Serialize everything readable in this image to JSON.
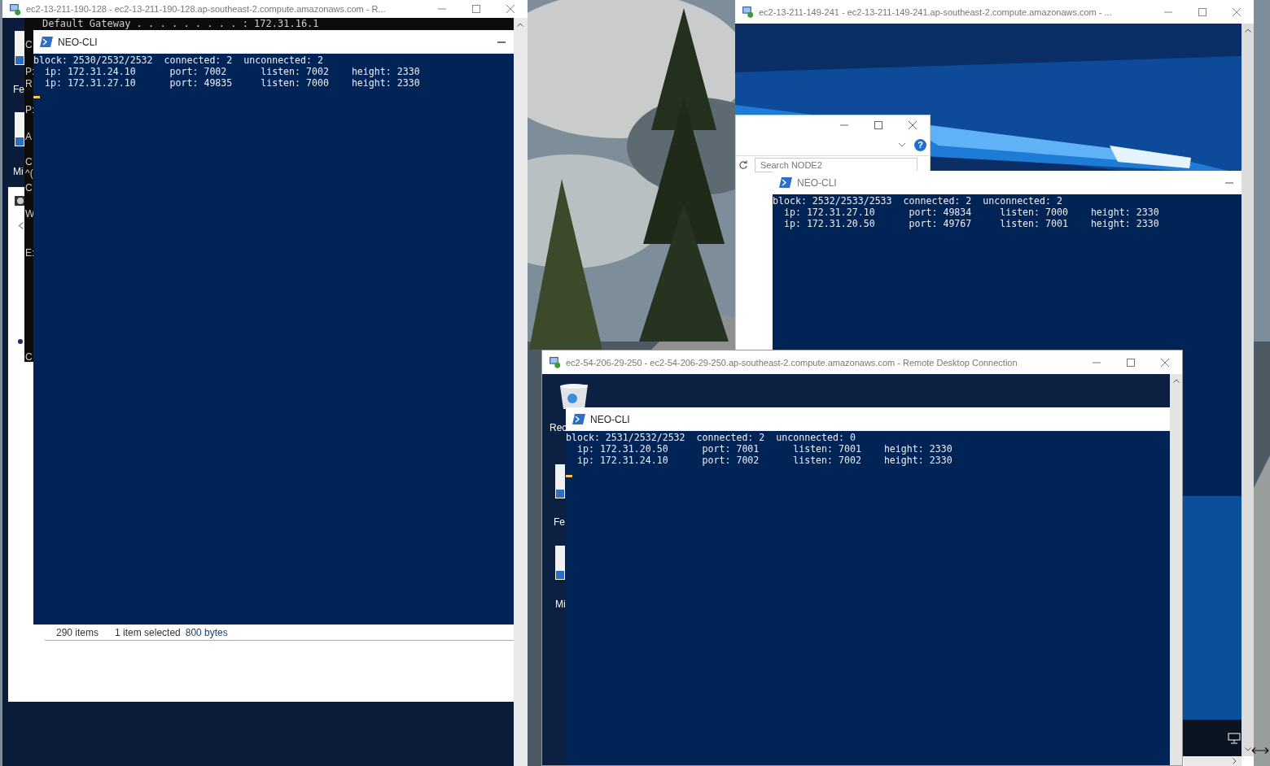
{
  "left_window": {
    "title": "ec2-13-211-190-128 - ec2-13-211-190-128.ap-southeast-2.compute.amazonaws.com - R...",
    "console_line": "Default Gateway . . . . . . . . . : 172.31.16.1",
    "console_fragments": [
      "C",
      "P:",
      "R",
      "P:",
      "A",
      "C",
      "^(",
      "C",
      "W",
      "E:",
      "C"
    ],
    "desktop_icons": [
      {
        "label": "Fe"
      },
      {
        "label": "Mi"
      }
    ],
    "neo_cli": {
      "title": "NEO-CLI",
      "lines": [
        "block: 2530/2532/2532  connected: 2  unconnected: 2",
        "  ip: 172.31.24.10      port: 7002      listen: 7002    height: 2330",
        "  ip: 172.31.27.10      port: 49835     listen: 7000    height: 2330"
      ]
    },
    "status_bar": {
      "item_count": "290 items",
      "selection": "1 item selected",
      "size": "800 bytes"
    }
  },
  "top_right_window": {
    "title": "ec2-13-211-149-241 - ec2-13-211-149-241.ap-southeast-2.compute.amazonaws.com - ...",
    "explorer": {
      "search": {
        "placeholder": "Search NODE2"
      },
      "help": "?"
    },
    "neo_cli": {
      "title": "NEO-CLI",
      "lines": [
        "block: 2532/2533/2533  connected: 2  unconnected: 2",
        "  ip: 172.31.27.10      port: 49834     listen: 7000    height: 2330",
        "  ip: 172.31.20.50      port: 49767     listen: 7001    height: 2330"
      ]
    }
  },
  "bottom_window": {
    "title": "ec2-54-206-29-250 - ec2-54-206-29-250.ap-southeast-2.compute.amazonaws.com - Remote Desktop Connection",
    "desktop_icons": [
      {
        "label": "Rec"
      },
      {
        "label": "Fe"
      },
      {
        "label": "Mi"
      }
    ],
    "neo_cli": {
      "title": "NEO-CLI",
      "lines": [
        "block: 2531/2532/2532  connected: 2  unconnected: 0",
        "  ip: 172.31.20.50      port: 7001      listen: 7001    height: 2330",
        "  ip: 172.31.24.10      port: 7002      listen: 7002    height: 2330"
      ]
    }
  }
}
